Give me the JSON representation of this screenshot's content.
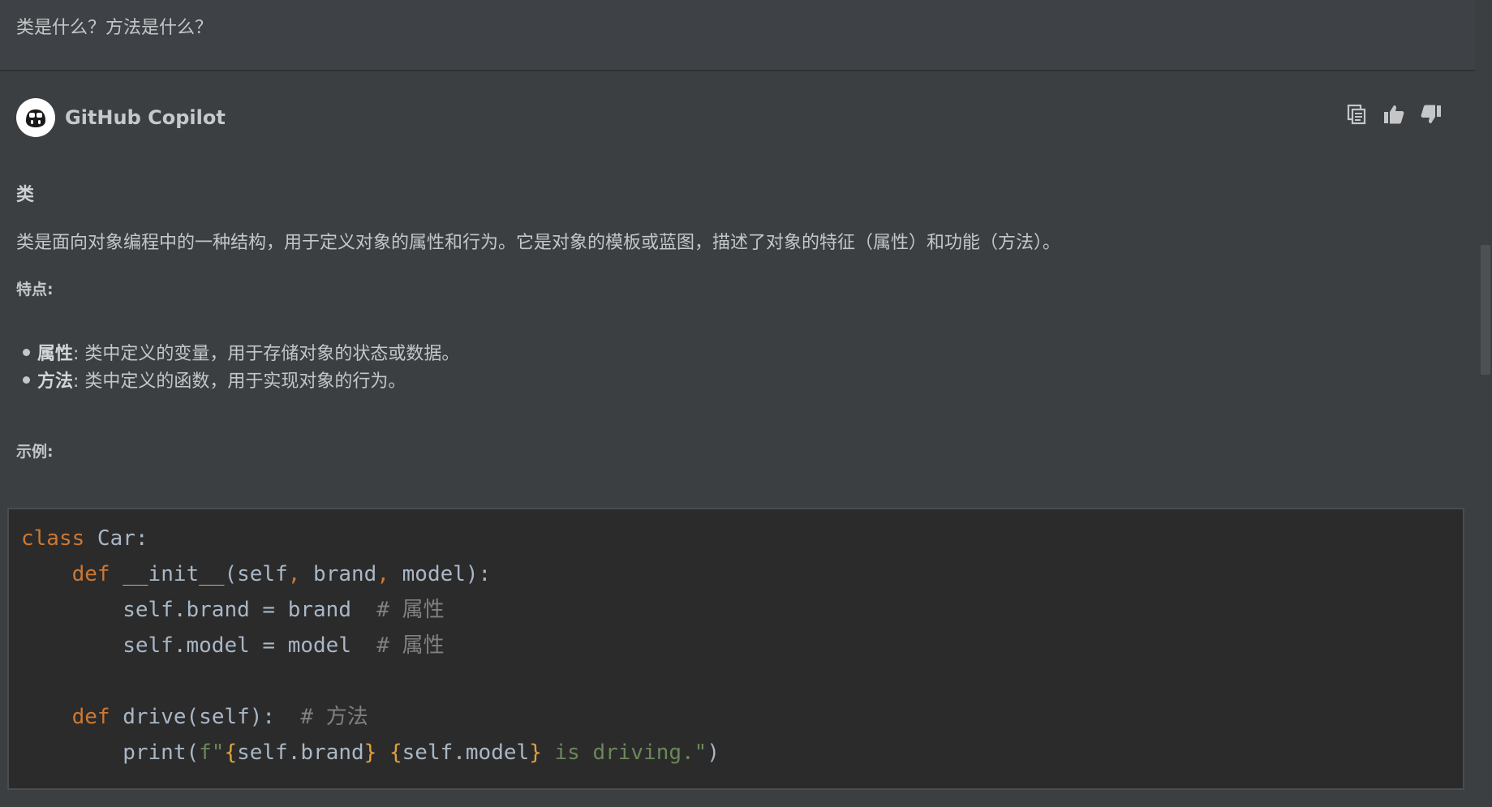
{
  "question": {
    "text": "类是什么？方法是什么？"
  },
  "assistant": {
    "name": "GitHub Copilot",
    "avatar_icon": "copilot-logo-icon",
    "actions": [
      {
        "name": "copy",
        "icon": "copy-icon"
      },
      {
        "name": "like",
        "icon": "thumbs-up-icon"
      },
      {
        "name": "dislike",
        "icon": "thumbs-down-icon"
      }
    ]
  },
  "content": {
    "heading": "类",
    "paragraph": "类是面向对象编程中的一种结构，用于定义对象的属性和行为。它是对象的模板或蓝图，描述了对象的特征（属性）和功能（方法）。",
    "features_label": "特点:",
    "bullets": [
      {
        "term": "属性",
        "desc": ": 类中定义的变量，用于存储对象的状态或数据。"
      },
      {
        "term": "方法",
        "desc": ": 类中定义的函数，用于实现对象的行为。"
      }
    ],
    "example_label": "示例:"
  },
  "code": {
    "language": "python",
    "tokens": {
      "class_kw": "class",
      "class_name": " Car:",
      "def_kw": "def",
      "init_sig": " __init__(self",
      "comma": ",",
      "brand_param": " brand",
      "model_param": " model):",
      "brand_assign": "        self.brand = brand  ",
      "model_assign": "        self.model = model  ",
      "comment_attr": "# 属性",
      "drive_sig": " drive(self):  ",
      "comment_method": "# 方法",
      "print_open": "        print(",
      "fstr_prefix": "f\"",
      "brace_open": "{",
      "self_brand": "self.brand",
      "brace_close": "}",
      "space": " ",
      "self_model": "self.model",
      "fstr_tail": " is driving.\"",
      "paren_close": ")"
    }
  },
  "colors": {
    "background": "#3c3f41",
    "code_bg": "#2b2b2b",
    "keyword": "#cc7832",
    "comment": "#808080",
    "string": "#6a8759"
  }
}
